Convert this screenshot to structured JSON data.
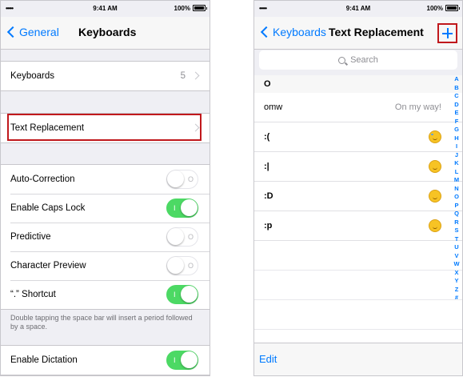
{
  "left": {
    "status": {
      "signal": "•••••",
      "time": "9:41 AM",
      "battery": "100%"
    },
    "nav": {
      "back": "General",
      "title": "Keyboards"
    },
    "keyboards_row": {
      "label": "Keyboards",
      "value": "5"
    },
    "text_replacement_row": {
      "label": "Text Replacement"
    },
    "toggles": [
      {
        "label": "Auto-Correction",
        "on": false,
        "mark": "O"
      },
      {
        "label": "Enable Caps Lock",
        "on": true,
        "mark": "I"
      },
      {
        "label": "Predictive",
        "on": false,
        "mark": "O"
      },
      {
        "label": "Character Preview",
        "on": false,
        "mark": "O"
      },
      {
        "label": "“.” Shortcut",
        "on": true,
        "mark": "I"
      }
    ],
    "footnote": "Double tapping the space bar will insert a period followed by a space.",
    "dictation": {
      "label": "Enable Dictation",
      "on": true,
      "mark": "I"
    }
  },
  "right": {
    "status": {
      "signal": "•••••",
      "time": "9:41 AM",
      "battery": "100%"
    },
    "nav": {
      "back": "Keyboards",
      "title": "Text Replacement"
    },
    "search": {
      "placeholder": "Search"
    },
    "section": "O",
    "rows": [
      {
        "shortcut": "omw",
        "phrase": "On my way!",
        "emoji": null
      },
      {
        "shortcut": ":(",
        "phrase": "",
        "emoji": "crying-face-icon"
      },
      {
        "shortcut": ":|",
        "phrase": "",
        "emoji": "neutral-face-icon"
      },
      {
        "shortcut": ":D",
        "phrase": "",
        "emoji": "grinning-face-icon"
      },
      {
        "shortcut": ":p",
        "phrase": "",
        "emoji": "tongue-face-icon"
      }
    ],
    "index": [
      "A",
      "B",
      "C",
      "D",
      "E",
      "F",
      "G",
      "H",
      "I",
      "J",
      "K",
      "L",
      "M",
      "N",
      "O",
      "P",
      "Q",
      "R",
      "S",
      "T",
      "U",
      "V",
      "W",
      "X",
      "Y",
      "Z",
      "#"
    ],
    "toolbar": {
      "edit": "Edit"
    }
  },
  "colors": {
    "accent": "#007aff",
    "switch_on": "#4cd964",
    "highlight": "#c0181c"
  }
}
